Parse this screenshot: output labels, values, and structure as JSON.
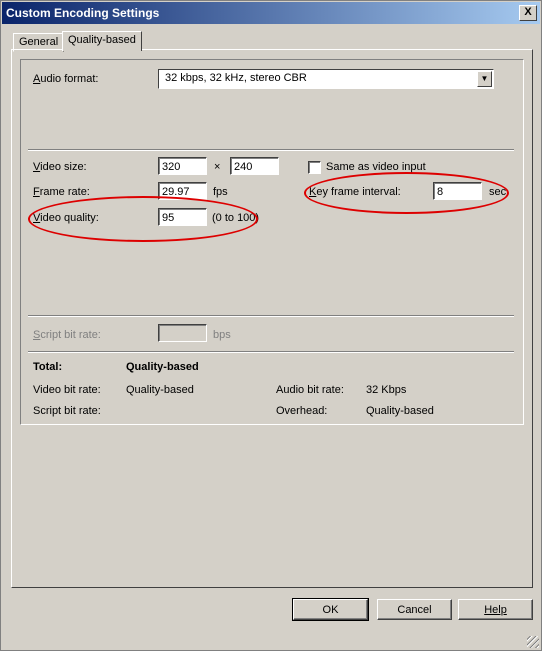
{
  "window": {
    "title": "Custom Encoding Settings",
    "close_glyph": "X"
  },
  "tabs": [
    {
      "label": "General"
    },
    {
      "label": "Quality-based"
    }
  ],
  "audio": {
    "format_label_ul": "A",
    "format_label_rest": "udio format:",
    "format_value": "32 kbps, 32 kHz, stereo CBR"
  },
  "video": {
    "size_label_ul": "V",
    "size_label_rest": "ideo size:",
    "width": "320",
    "times": "×",
    "height": "240",
    "same_as_input": "Same as video input",
    "frame_rate_label_ul": "F",
    "frame_rate_label_rest": "rame rate:",
    "frame_rate": "29.97",
    "fps": "fps",
    "key_frame_label_ul": "K",
    "key_frame_label_rest": "ey frame interval:",
    "key_frame": "8",
    "sec": "sec",
    "quality_label_ul": "V",
    "quality_label_rest": "ideo quality:",
    "quality": "95",
    "quality_range": "(0 to 100)"
  },
  "script": {
    "label_ul": "S",
    "label_rest": "cript bit rate:",
    "value": "",
    "unit": "bps"
  },
  "summary": {
    "total_label": "Total:",
    "total_value": "Quality-based",
    "video_bit_rate_label": "Video bit rate:",
    "video_bit_rate": "Quality-based",
    "audio_bit_rate_label": "Audio bit rate:",
    "audio_bit_rate": "32 Kbps",
    "script_bit_rate_label": "Script bit rate:",
    "script_bit_rate": "",
    "overhead_label": "Overhead:",
    "overhead": "Quality-based"
  },
  "buttons": {
    "ok": "OK",
    "cancel": "Cancel",
    "help": "Help"
  },
  "annotation_color": "#dd0000"
}
